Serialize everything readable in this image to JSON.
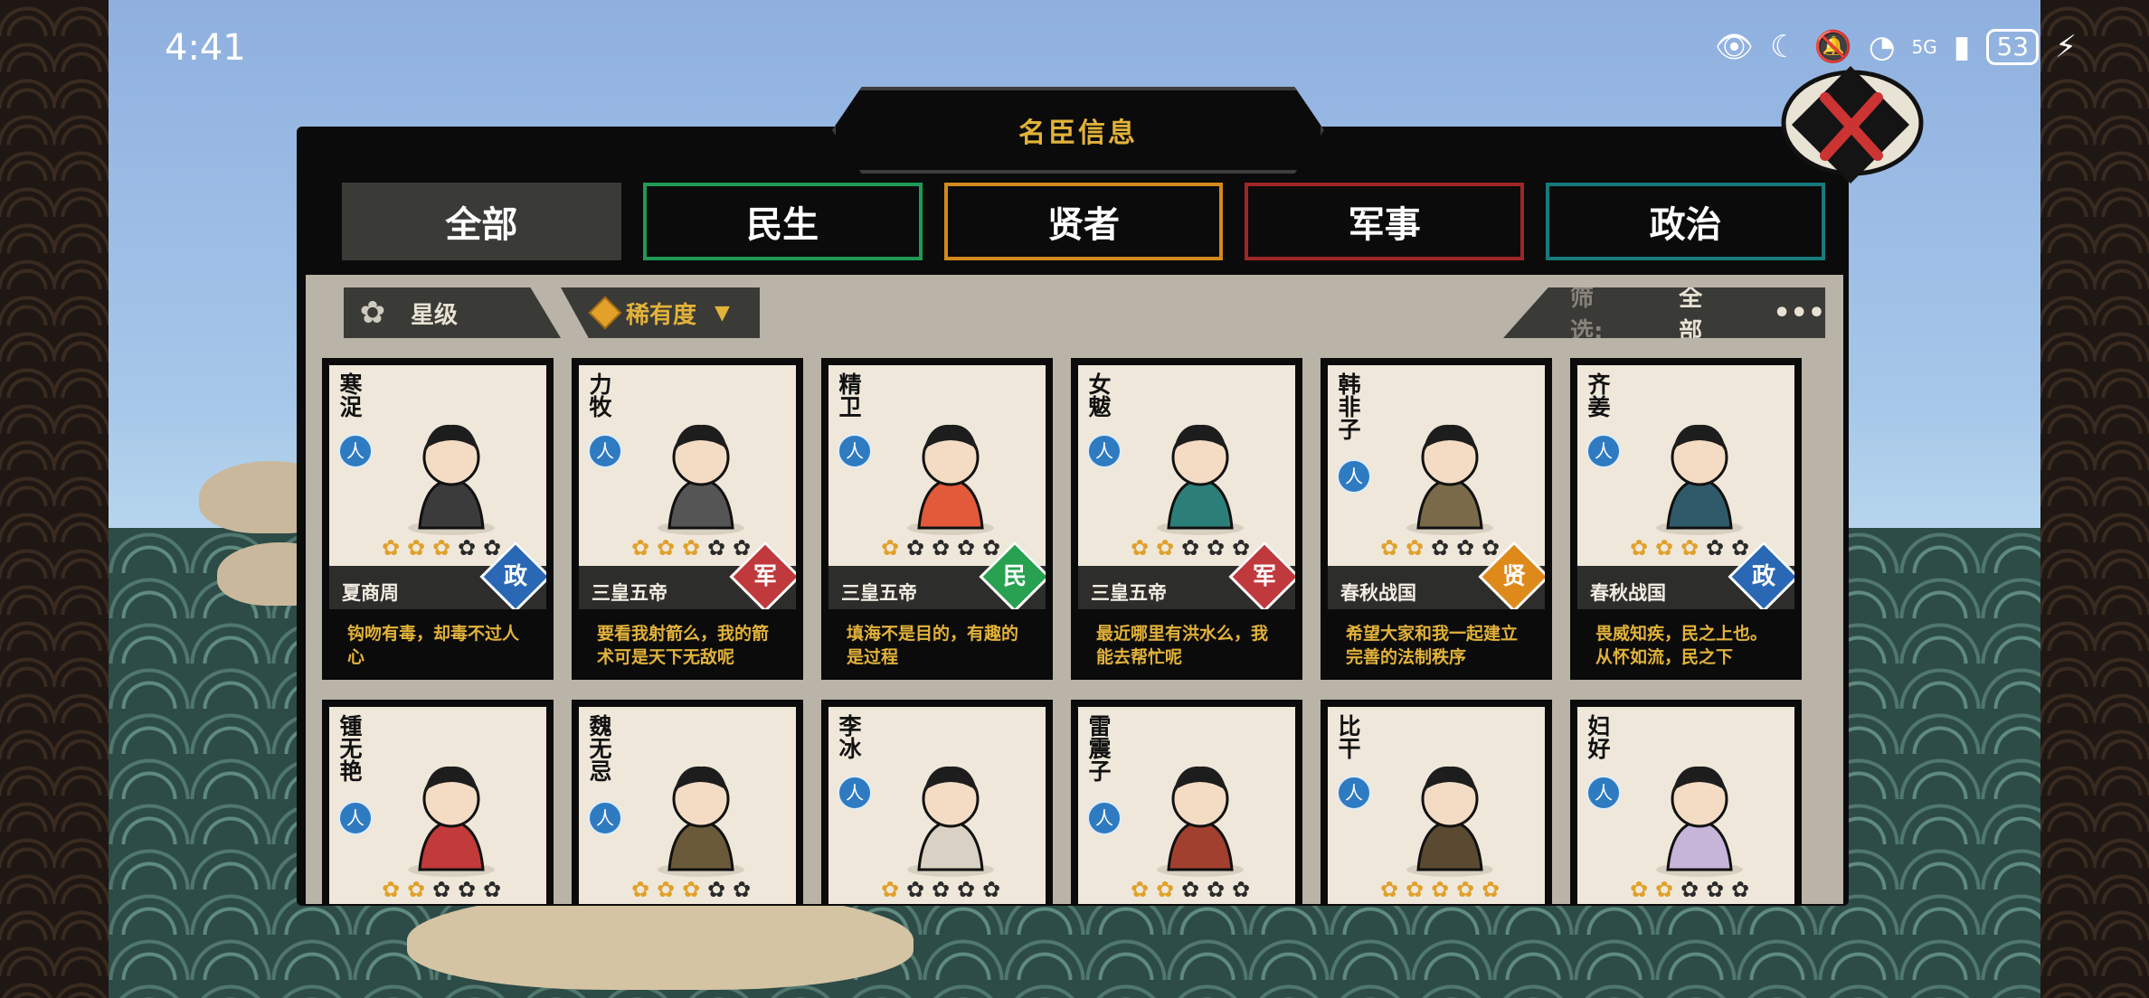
{
  "status_bar": {
    "time": "4:41",
    "battery": "53",
    "network": "5G"
  },
  "panel": {
    "title": "名臣信息"
  },
  "tabs": [
    {
      "label": "全部",
      "color": "#3a3a37"
    },
    {
      "label": "民生",
      "color": "#1f9a55"
    },
    {
      "label": "贤者",
      "color": "#d28a1c"
    },
    {
      "label": "军事",
      "color": "#9f2628"
    },
    {
      "label": "政治",
      "color": "#177a7c"
    }
  ],
  "filters": {
    "star_label": "星级",
    "rarity_label": "稀有度",
    "screen_label": "筛选:",
    "screen_value": "全部",
    "more_label": "•••"
  },
  "cards": [
    {
      "name": "寒浞",
      "stars": 3,
      "era": "夏商周",
      "category": "政",
      "quote": "钩吻有毒，却毒不过人心"
    },
    {
      "name": "力牧",
      "stars": 3,
      "era": "三皇五帝",
      "category": "军",
      "quote": "要看我射箭么，我的箭术可是天下无敌呢"
    },
    {
      "name": "精卫",
      "stars": 1,
      "era": "三皇五帝",
      "category": "民",
      "quote": "填海不是目的，有趣的是过程"
    },
    {
      "name": "女魃",
      "stars": 2,
      "era": "三皇五帝",
      "category": "军",
      "quote": "最近哪里有洪水么，我能去帮忙呢"
    },
    {
      "name": "韩非子",
      "stars": 2,
      "era": "春秋战国",
      "category": "贤",
      "quote": "希望大家和我一起建立完善的法制秩序"
    },
    {
      "name": "齐姜",
      "stars": 3,
      "era": "春秋战国",
      "category": "政",
      "quote": "畏威知疾，民之上也。从怀如流，民之下"
    },
    {
      "name": "锺无艳",
      "stars": 2,
      "era": "",
      "category": "",
      "quote": ""
    },
    {
      "name": "魏无忌",
      "stars": 3,
      "era": "",
      "category": "",
      "quote": ""
    },
    {
      "name": "李冰",
      "stars": 1,
      "era": "",
      "category": "",
      "quote": ""
    },
    {
      "name": "雷震子",
      "stars": 2,
      "era": "",
      "category": "",
      "quote": ""
    },
    {
      "name": "比干",
      "stars": 5,
      "era": "",
      "category": "",
      "quote": ""
    },
    {
      "name": "妇好",
      "stars": 2,
      "era": "",
      "category": "",
      "quote": ""
    }
  ]
}
